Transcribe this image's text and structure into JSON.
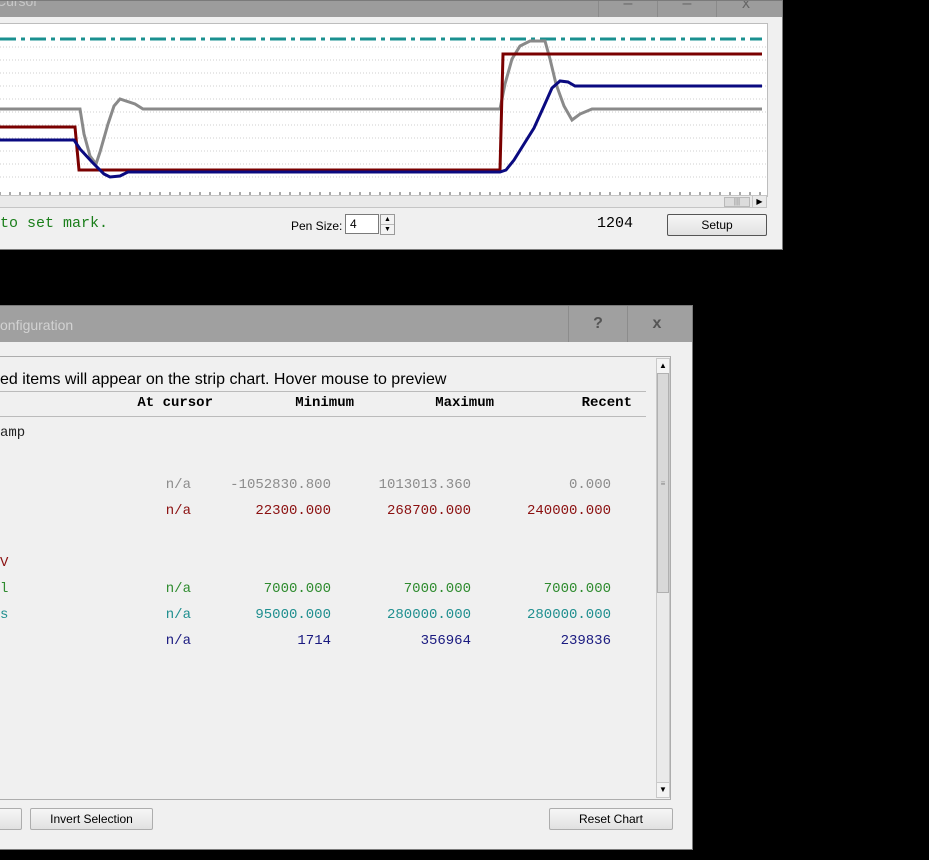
{
  "strip_window": {
    "title": "Cursor",
    "title_buttons": [
      "minimize",
      "maximize",
      "close"
    ],
    "status_hint": "to set mark.",
    "pen_size_label": "Pen Size:",
    "pen_size_value": "4",
    "cursor_value": "1204",
    "setup_label": "Setup"
  },
  "config_window": {
    "title": "onfiguration",
    "help_label": "?",
    "close_label": "x",
    "instructions": "ed items will appear on the strip chart.   Hover mouse to preview",
    "headers": {
      "at_cursor": "At cursor",
      "minimum": "Minimum",
      "maximum": "Maximum",
      "recent": "Recent"
    },
    "rows": [
      {
        "name": "amp",
        "at_cursor": "",
        "minimum": "",
        "maximum": "",
        "recent": "",
        "color": "#222222"
      },
      {
        "name": "",
        "at_cursor": "n/a",
        "minimum": "-1052830.800",
        "maximum": "1013013.360",
        "recent": "0.000",
        "color": "#8c8c8c"
      },
      {
        "name": "",
        "at_cursor": "n/a",
        "minimum": "22300.000",
        "maximum": "268700.000",
        "recent": "240000.000",
        "color": "#8b1010"
      },
      {
        "name": "V",
        "at_cursor": "",
        "minimum": "",
        "maximum": "",
        "recent": "",
        "color": "#8b1010"
      },
      {
        "name": "l",
        "at_cursor": "n/a",
        "minimum": "7000.000",
        "maximum": "7000.000",
        "recent": "7000.000",
        "color": "#2e8b2e"
      },
      {
        "name": "s",
        "at_cursor": "n/a",
        "minimum": "95000.000",
        "maximum": "280000.000",
        "recent": "280000.000",
        "color": "#1f8f8f"
      },
      {
        "name": "",
        "at_cursor": "n/a",
        "minimum": "1714",
        "maximum": "356964",
        "recent": "239836",
        "color": "#1a1a80"
      }
    ],
    "invert_label": "Invert Selection",
    "reset_label": "Reset Chart"
  },
  "colors": {
    "gray": "#8a8a8a",
    "maroon": "#7a0000",
    "navy": "#0a0a80",
    "teal": "#1a9090"
  }
}
